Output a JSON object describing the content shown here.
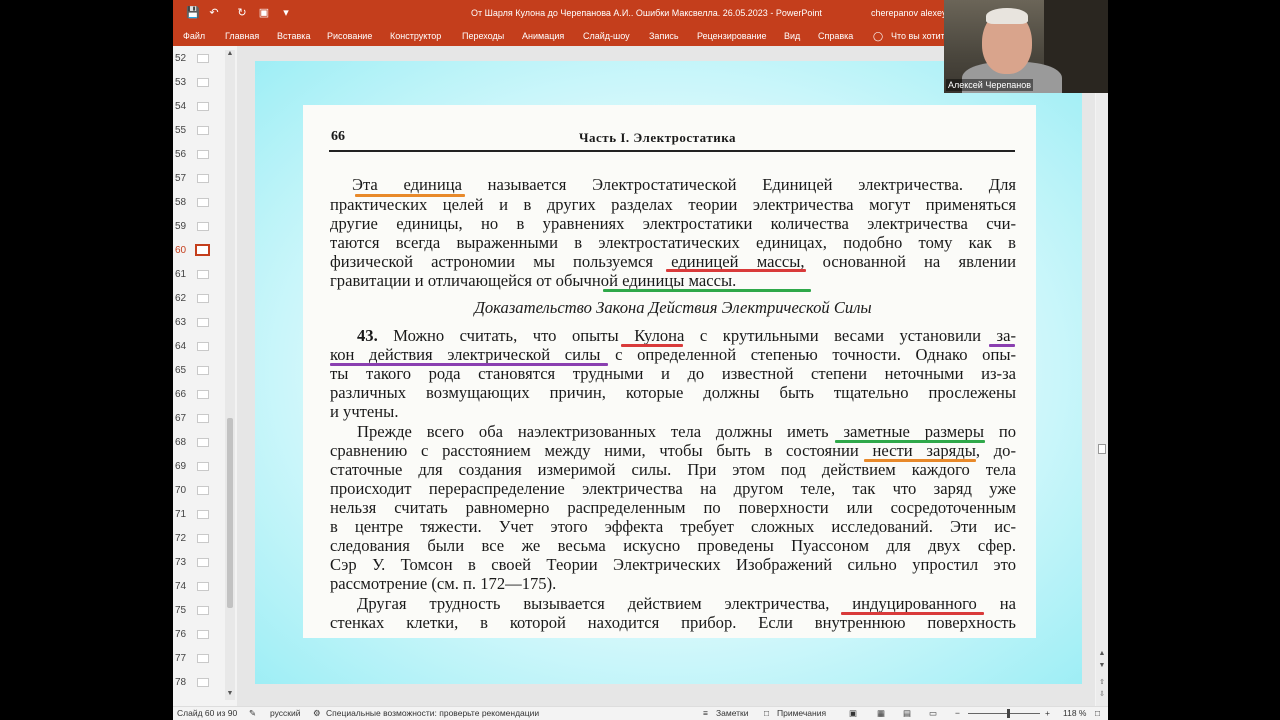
{
  "titlebar": {
    "document_title": "От Шарля Кулона до Черепанова А.И.. Ошибки Максвелла. 26.05.2023  -  PowerPoint",
    "user": "cherepanov alexey",
    "quick_access": [
      "save-icon",
      "undo-icon",
      "redo-icon",
      "present-icon",
      "customize-icon"
    ]
  },
  "ribbon": {
    "tabs": [
      "Файл",
      "Главная",
      "Вставка",
      "Рисование",
      "Конструктор",
      "Переходы",
      "Анимация",
      "Слайд-шоу",
      "Запись",
      "Рецензирование",
      "Вид",
      "Справка",
      "Что вы хотите"
    ]
  },
  "thumbnails": {
    "numbers": [
      "52",
      "53",
      "54",
      "55",
      "56",
      "57",
      "58",
      "59",
      "60",
      "61",
      "62",
      "63",
      "64",
      "65",
      "66",
      "67",
      "68",
      "69",
      "70",
      "71",
      "72",
      "73",
      "74",
      "75",
      "76",
      "77",
      "78"
    ],
    "active": "60"
  },
  "slide": {
    "page_number": "66",
    "running_head": "Часть I. Электростатика",
    "lines": [
      "Эта единица называется Электростатической Единицей электричества. Для",
      "практических целей и в других разделах теории электричества могут применяться",
      "другие единицы, но в уравнениях электростатики количества электричества счи-",
      "таются всегда выраженными в электростатических единицах, подобно тому как в",
      "физической астрономии мы пользуемся единицей массы, основанной на явлении",
      "гравитации и отличающейся от обычной единицы массы.",
      "Доказательство Закона Действия Электрической Силы",
      "Можно считать, что опыты Кулона с крутильными весами установили за-",
      "кон действия электрической силы с определенной степенью точности. Однако опы-",
      "ты такого рода становятся трудными и до известной степени неточными из-за",
      "различных возмущающих причин, которые должны быть тщательно прослежены",
      "и учтены.",
      "Прежде всего оба наэлектризованных тела должны иметь заметные размеры по",
      "сравнению с расстоянием между ними, чтобы быть в состоянии нести заряды, до-",
      "статочные для создания измеримой силы. При этом под действием каждого тела",
      "происходит перераспределение электричества на другом теле, так что заряд уже",
      "нельзя считать равномерно распределенным по поверхности или сосредоточенным",
      "в центре тяжести. Учет этого эффекта требует сложных исследований. Эти ис-",
      "следования были все же весьма искусно проведены Пуассоном для двух сфер.",
      "Сэр У. Томсон в своей Теории Электрических Изображений сильно упростил это",
      "рассмотрение (см. п. 172—175).",
      "Другая трудность вызывается действием электричества, индуцированного на",
      "стенках клетки, в которой находится прибор. Если внутреннюю поверхность"
    ],
    "section_number": "43.",
    "underline_colors": {
      "orange": "#e8892a",
      "red": "#d93a3a",
      "green": "#2fa84a",
      "purple": "#8a3fb0"
    }
  },
  "webcam": {
    "name": "Алексей Черепанов"
  },
  "statusbar": {
    "slide_counter": "Слайд 60 из 90",
    "language": "русский",
    "accessibility": "Специальные возможности: проверьте рекомендации",
    "notes": "Заметки",
    "comments": "Примечания",
    "zoom": "118 %"
  }
}
